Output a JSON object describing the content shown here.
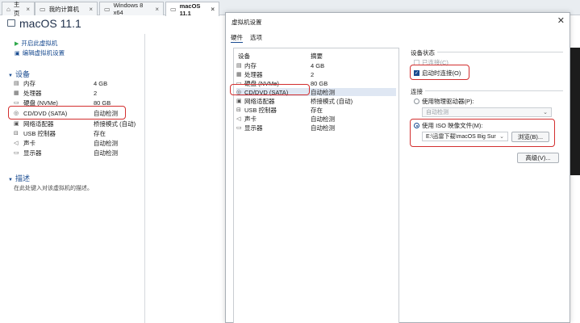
{
  "tabs": [
    {
      "label": "主页",
      "icon": "home-icon"
    },
    {
      "label": "我的计算机",
      "icon": "computer-icon"
    },
    {
      "label": "Windows 8 x64",
      "icon": "vm-icon"
    },
    {
      "label": "macOS 11.1",
      "icon": "vm-icon"
    }
  ],
  "vm": {
    "title": "macOS 11.1",
    "actions": [
      "开启此虚拟机",
      "编辑虚拟机设置"
    ],
    "devices_header": "设备",
    "devices": [
      {
        "name": "内存",
        "value": "4 GB",
        "icon": "memory-icon"
      },
      {
        "name": "处理器",
        "value": "2",
        "icon": "cpu-icon"
      },
      {
        "name": "硬盘 (NVMe)",
        "value": "80 GB",
        "icon": "disk-icon"
      },
      {
        "name": "CD/DVD (SATA)",
        "value": "自动检测",
        "icon": "cd-icon"
      },
      {
        "name": "网络适配器",
        "value": "桥接模式 (自动)",
        "icon": "network-icon"
      },
      {
        "name": "USB 控制器",
        "value": "存在",
        "icon": "usb-icon"
      },
      {
        "name": "声卡",
        "value": "自动检测",
        "icon": "sound-icon"
      },
      {
        "name": "显示器",
        "value": "自动检测",
        "icon": "display-icon"
      }
    ],
    "desc_header": "描述",
    "desc_text": "在此处键入对该虚拟机的描述。"
  },
  "dialog": {
    "title": "虚拟机设置",
    "close": "✕",
    "tabs": [
      "硬件",
      "选项"
    ],
    "list_header": {
      "device": "设备",
      "summary": "摘要"
    },
    "list": [
      {
        "name": "内存",
        "value": "4 GB"
      },
      {
        "name": "处理器",
        "value": "2"
      },
      {
        "name": "硬盘 (NVMe)",
        "value": "80 GB"
      },
      {
        "name": "CD/DVD (SATA)",
        "value": "自动检测"
      },
      {
        "name": "网络适配器",
        "value": "桥接模式 (自动)"
      },
      {
        "name": "USB 控制器",
        "value": "存在"
      },
      {
        "name": "声卡",
        "value": "自动检测"
      },
      {
        "name": "显示器",
        "value": "自动检测"
      }
    ],
    "device_status_label": "设备状态",
    "connected_label": "已连接(C)",
    "connect_on_power_label": "启动时连接(O)",
    "connection_label": "连接",
    "physical_drive_label": "使用物理驱动器(P):",
    "physical_drive_value": "自动检测",
    "iso_label": "使用 ISO 映像文件(M):",
    "iso_path": "E:\\迅雷下载\\macOS Big Sur",
    "browse_button": "浏览(B)...",
    "advanced_button": "高级(V)..."
  },
  "colors": {
    "accent": "#1a4c91",
    "highlight": "#d32f2f"
  }
}
